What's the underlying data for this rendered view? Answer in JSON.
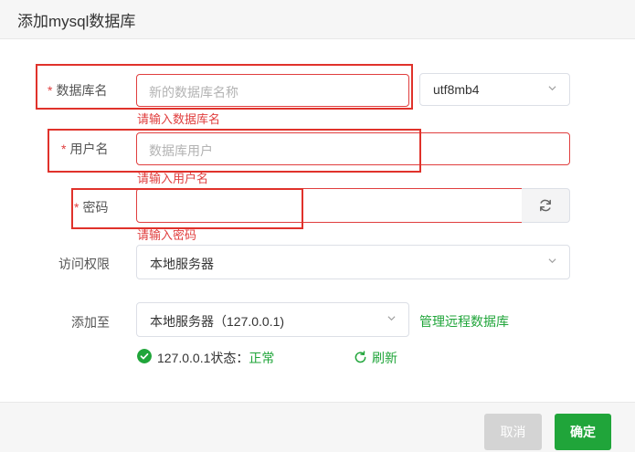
{
  "dialog": {
    "title": "添加mysql数据库"
  },
  "form": {
    "db_name": {
      "label": "数据库名",
      "placeholder": "新的数据库名称",
      "charset": "utf8mb4",
      "error": "请输入数据库名"
    },
    "user": {
      "label": "用户名",
      "placeholder": "数据库用户",
      "error": "请输入用户名"
    },
    "password": {
      "label": "密码",
      "error": "请输入密码"
    },
    "access": {
      "label": "访问权限",
      "value": "本地服务器"
    },
    "add_to": {
      "label": "添加至",
      "value": "本地服务器（127.0.0.1)",
      "manage_link": "管理远程数据库"
    },
    "status": {
      "prefix": "127.0.0.1状态：",
      "state": "正常",
      "refresh_label": "刷新"
    },
    "required_mark": "*"
  },
  "footer": {
    "cancel_label": "取消",
    "confirm_label": "确定"
  },
  "colors": {
    "accent": "#20a53a",
    "error": "#e03e3e"
  }
}
